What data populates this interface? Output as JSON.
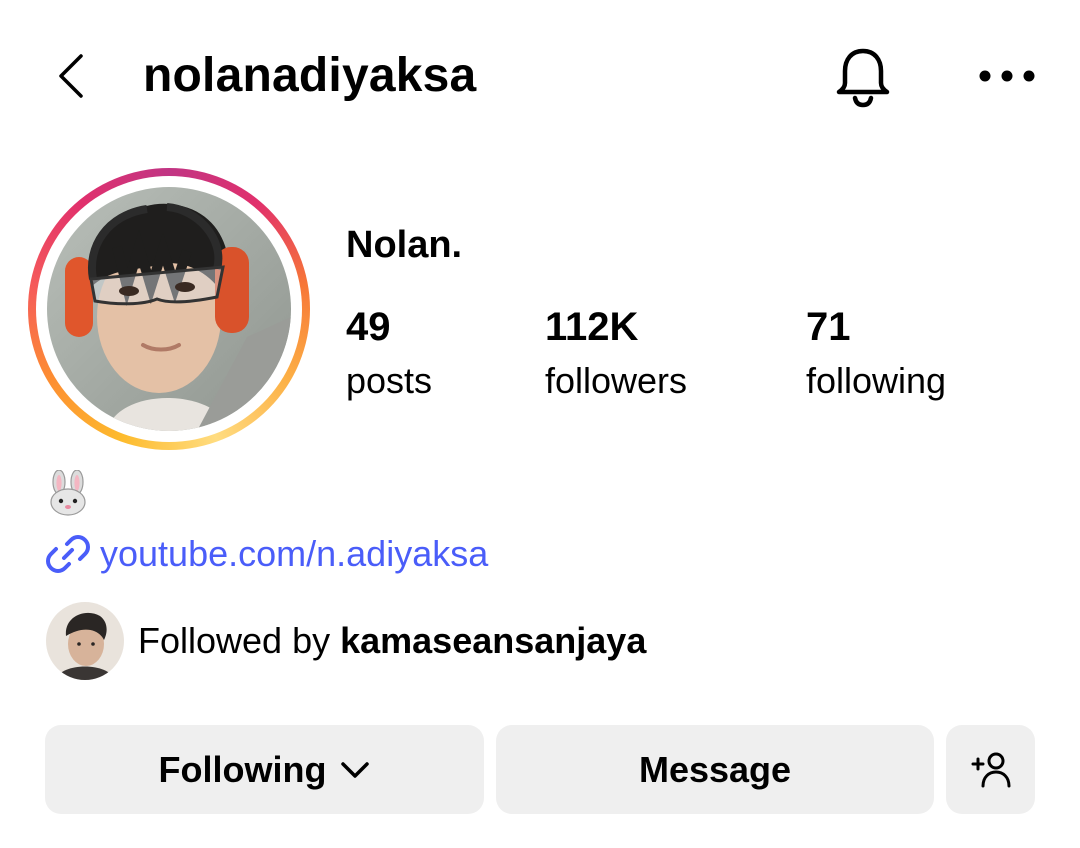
{
  "header": {
    "username": "nolanadiyaksa",
    "icons": {
      "back": "chevron-left-icon",
      "notifications": "bell-icon",
      "more": "more-horizontal-icon"
    }
  },
  "profile": {
    "display_name": "Nolan.",
    "avatar": "profile-photo",
    "stats": [
      {
        "value": "49",
        "label": "posts"
      },
      {
        "value": "112K",
        "label": "followers"
      },
      {
        "value": "71",
        "label": "following"
      }
    ],
    "bio_emoji": "🐰",
    "link": {
      "text": "youtube.com/n.adiyaksa",
      "icon": "link-icon",
      "color": "#4a5df9"
    },
    "followed_by": {
      "prefix": "Followed by ",
      "username": "kamaseansanjaya"
    }
  },
  "actions": {
    "following_label": "Following",
    "message_label": "Message",
    "add_person_icon": "add-person-icon",
    "button_bg": "#efefef"
  },
  "colors": {
    "story_ring": [
      "#fdbb2d",
      "#f55a5a",
      "#e1306c",
      "#c13584"
    ],
    "text": "#000000",
    "link": "#4a5df9"
  }
}
